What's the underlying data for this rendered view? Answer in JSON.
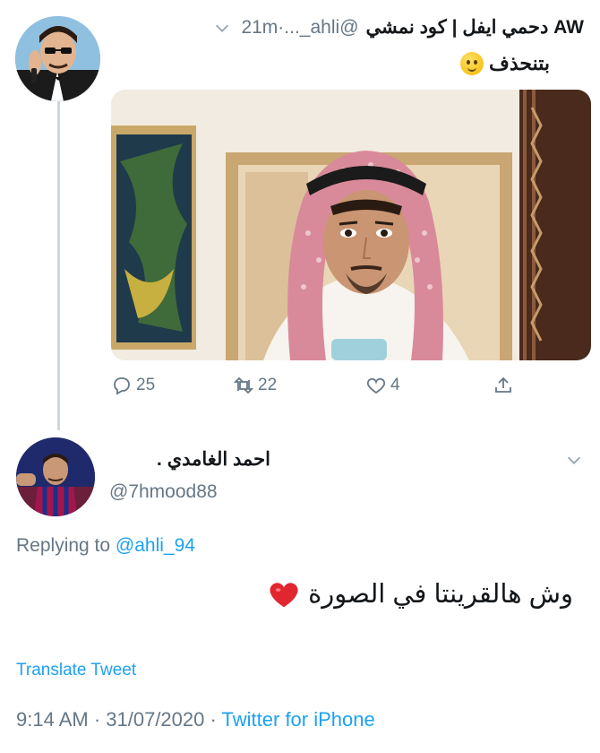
{
  "original_tweet": {
    "display_name": "AW دحمي ايفل | كود نمشي",
    "handle": "@ahli_...",
    "time": "·21m",
    "text": "بتنحذف",
    "emoji": "slightly-smiling-face",
    "stats": {
      "replies": "25",
      "retweets": "22",
      "likes": "4"
    }
  },
  "reply_tweet": {
    "display_name": "احمد الغامدي .",
    "handle": "@7hmood88",
    "replying_prefix": "Replying to",
    "replying_to": "@ahli_94",
    "text": "وش هالقرينتا في الصورة",
    "emoji": "red-heart",
    "translate_label": "Translate Tweet",
    "timestamp": "9:14 AM · 31/07/2020 ·",
    "source": "Twitter for iPhone"
  },
  "colors": {
    "link": "#1da1f2",
    "muted": "#657786",
    "text": "#14171a",
    "thread_line": "#ccd6dd"
  },
  "icons": [
    "chevron-down-icon",
    "reply-icon",
    "retweet-icon",
    "like-icon",
    "share-icon"
  ]
}
